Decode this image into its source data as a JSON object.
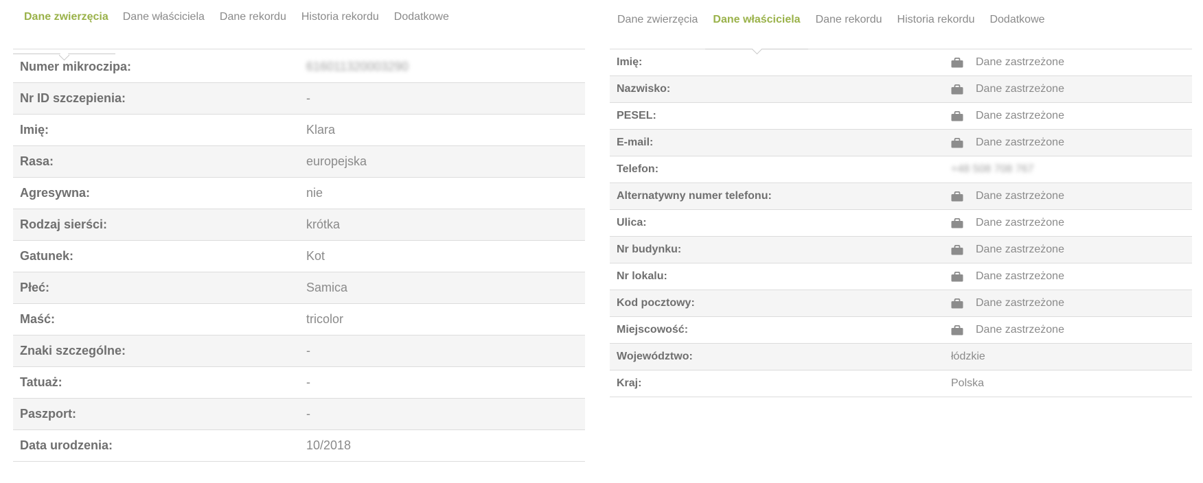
{
  "left": {
    "tabs": [
      {
        "label": "Dane zwierzęcia",
        "active": true
      },
      {
        "label": "Dane właściciela",
        "active": false
      },
      {
        "label": "Dane rekordu",
        "active": false
      },
      {
        "label": "Historia rekordu",
        "active": false
      },
      {
        "label": "Dodatkowe",
        "active": false
      }
    ],
    "rows": [
      {
        "label": "Numer mikroczipa:",
        "value": "616011320003290",
        "blurred": true
      },
      {
        "label": "Nr ID szczepienia:",
        "value": "-"
      },
      {
        "label": "Imię:",
        "value": "Klara"
      },
      {
        "label": "Rasa:",
        "value": "europejska"
      },
      {
        "label": "Agresywna:",
        "value": "nie"
      },
      {
        "label": "Rodzaj sierści:",
        "value": "krótka"
      },
      {
        "label": "Gatunek:",
        "value": "Kot"
      },
      {
        "label": "Płeć:",
        "value": "Samica"
      },
      {
        "label": "Maść:",
        "value": "tricolor"
      },
      {
        "label": "Znaki szczególne:",
        "value": "-"
      },
      {
        "label": "Tatuaż:",
        "value": "-"
      },
      {
        "label": "Paszport:",
        "value": "-"
      },
      {
        "label": "Data urodzenia:",
        "value": "10/2018"
      }
    ]
  },
  "right": {
    "tabs": [
      {
        "label": "Dane zwierzęcia",
        "active": false
      },
      {
        "label": "Dane właściciela",
        "active": true
      },
      {
        "label": "Dane rekordu",
        "active": false
      },
      {
        "label": "Historia rekordu",
        "active": false
      },
      {
        "label": "Dodatkowe",
        "active": false
      }
    ],
    "rows": [
      {
        "label": "Imię:",
        "value": "Dane zastrzeżone",
        "locked": true
      },
      {
        "label": "Nazwisko:",
        "value": "Dane zastrzeżone",
        "locked": true
      },
      {
        "label": "PESEL:",
        "value": "Dane zastrzeżone",
        "locked": true
      },
      {
        "label": "E-mail:",
        "value": "Dane zastrzeżone",
        "locked": true
      },
      {
        "label": "Telefon:",
        "value": "+48 508 708 767",
        "blurred": true
      },
      {
        "label": "Alternatywny numer telefonu:",
        "value": "Dane zastrzeżone",
        "locked": true
      },
      {
        "label": "Ulica:",
        "value": "Dane zastrzeżone",
        "locked": true
      },
      {
        "label": "Nr budynku:",
        "value": "Dane zastrzeżone",
        "locked": true
      },
      {
        "label": "Nr lokalu:",
        "value": "Dane zastrzeżone",
        "locked": true
      },
      {
        "label": "Kod pocztowy:",
        "value": "Dane zastrzeżone",
        "locked": true
      },
      {
        "label": "Miejscowość:",
        "value": "Dane zastrzeżone",
        "locked": true
      },
      {
        "label": "Województwo:",
        "value": "łódzkie"
      },
      {
        "label": "Kraj:",
        "value": "Polska"
      }
    ]
  },
  "colors": {
    "active_tab": "#9ab24a",
    "row_alt_bg": "#f5f5f5",
    "border": "#dcdcdc",
    "lock_icon": "#8c8c8c"
  },
  "icons": {
    "locked_value": "lock-icon"
  }
}
